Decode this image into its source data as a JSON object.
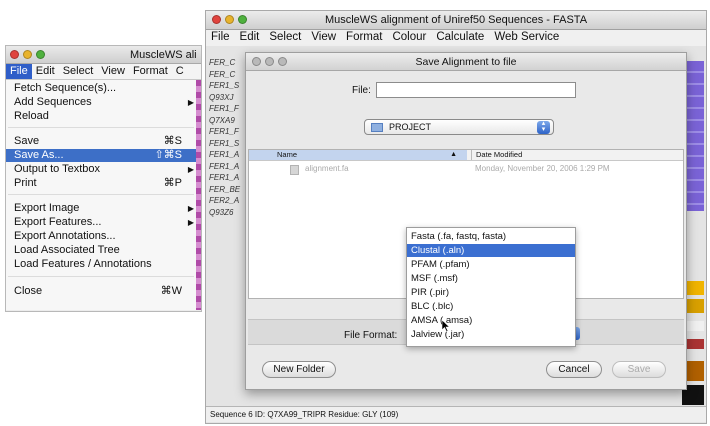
{
  "left_window": {
    "title": "MuscleWS ali",
    "menubar": [
      "File",
      "Edit",
      "Select",
      "View",
      "Format",
      "C"
    ],
    "file_menu": [
      {
        "label": "Fetch Sequence(s)...",
        "shortcut": "",
        "submenu": false
      },
      {
        "label": "Add Sequences",
        "shortcut": "",
        "submenu": true
      },
      {
        "label": "Reload",
        "shortcut": "",
        "submenu": false
      },
      {
        "label": "Save",
        "shortcut": "⌘S",
        "submenu": false
      },
      {
        "label": "Save As...",
        "shortcut": "⇧⌘S",
        "submenu": false,
        "highlighted": true
      },
      {
        "label": "Output to Textbox",
        "shortcut": "",
        "submenu": true
      },
      {
        "label": "Print",
        "shortcut": "⌘P",
        "submenu": false
      },
      {
        "label": "Export Image",
        "shortcut": "",
        "submenu": true
      },
      {
        "label": "Export Features...",
        "shortcut": "",
        "submenu": false
      },
      {
        "label": "Export Annotations...",
        "shortcut": "",
        "submenu": false
      },
      {
        "label": "Load Associated Tree",
        "shortcut": "",
        "submenu": false
      },
      {
        "label": "Load Features / Annotations",
        "shortcut": "",
        "submenu": false
      },
      {
        "label": "Close",
        "shortcut": "⌘W",
        "submenu": false
      }
    ]
  },
  "main_window": {
    "title": "MuscleWS alignment of Uniref50 Sequences - FASTA",
    "menubar": [
      "File",
      "Edit",
      "Select",
      "View",
      "Format",
      "Colour",
      "Calculate",
      "Web Service"
    ],
    "sequence_ids": [
      "FER_C",
      "FER_C",
      "FER1_S",
      "Q93XJ",
      "FER1_F",
      "Q7XA9",
      "FER1_F",
      "FER1_S",
      "FER1_A",
      "FER1_A",
      "FER1_A",
      "FER_BE",
      "FER2_A",
      "Q93Z6"
    ],
    "status_text": "Sequence 6 ID: Q7XA99_TRIPR  Residue: GLY (109)"
  },
  "dialog": {
    "title": "Save Alignment to file",
    "file_label": "File:",
    "file_value": "",
    "directory": "PROJECT",
    "columns": {
      "name": "Name",
      "date": "Date Modified"
    },
    "files": [
      {
        "name": "alignment.fa",
        "date": "Monday, November 20, 2006 1:29 PM"
      }
    ],
    "format_label": "File Format:",
    "format_options": [
      {
        "label": "Fasta (.fa, fastq, fasta)",
        "selected": false
      },
      {
        "label": "Clustal (.aln)",
        "selected": true
      },
      {
        "label": "PFAM (.pfam)",
        "selected": false
      },
      {
        "label": "MSF (.msf)",
        "selected": false
      },
      {
        "label": "PIR (.pir)",
        "selected": false
      },
      {
        "label": "BLC (.blc)",
        "selected": false
      },
      {
        "label": "AMSA (.amsa)",
        "selected": false
      },
      {
        "label": "Jalview (.jar)",
        "selected": false
      }
    ],
    "buttons": {
      "new_folder": "New Folder",
      "cancel": "Cancel",
      "save": "Save"
    }
  },
  "colors": {
    "menu_highlight": "#3d6fc7",
    "selection": "#3b6fd1",
    "alignment_purple": "#7a63d6",
    "magenta_strip": "#b04ba8"
  },
  "icons": {
    "folder": "folder-icon",
    "document": "document-icon",
    "popup_arrows": "updown-arrows-icon"
  }
}
